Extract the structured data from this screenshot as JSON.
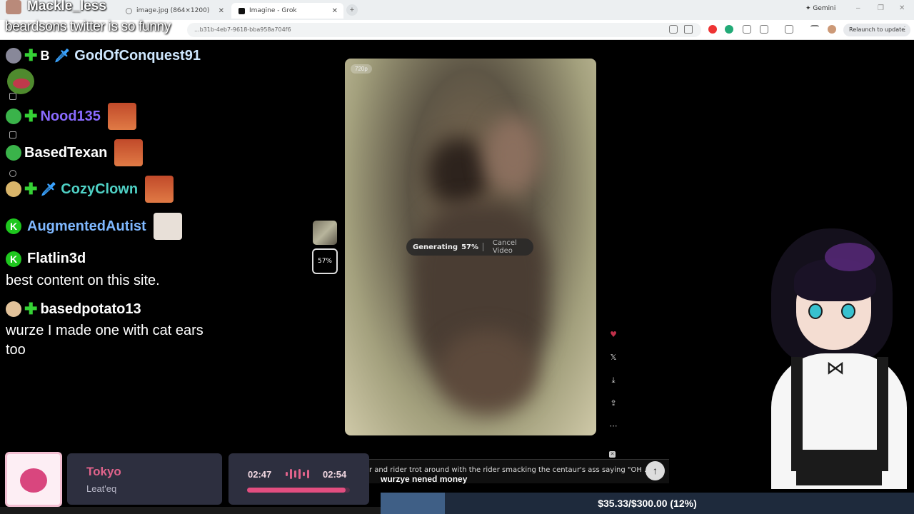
{
  "overlay": {
    "streamer_name": "Mackle_less",
    "stream_title": "beardsons twitter is so funny"
  },
  "browser": {
    "tabs": [
      {
        "label": "image.jpg (864×1200)",
        "active": false
      },
      {
        "label": "Imagine - Grok",
        "active": true
      }
    ],
    "new_tab": "+",
    "gemini_label": "Gemini",
    "url": "...b31b-4eb7-9618-bba958a704f6",
    "relaunch_label": "Relaunch to update",
    "window_controls": [
      "–",
      "❐",
      "✕"
    ]
  },
  "chat": {
    "messages": [
      {
        "user": "GodOfConquest91",
        "color": "#cfe8ff",
        "prefix": "B"
      },
      {
        "user": "Nood135",
        "color": "#8a6bff"
      },
      {
        "user": "BasedTexan",
        "color": "#ffffff"
      },
      {
        "user": "CozyClown",
        "color": "#4fd1c5"
      },
      {
        "user": "AugmentedAutist",
        "color": "#7fb8ff"
      },
      {
        "user": "Flatlin3d",
        "color": "#ffffff",
        "text": "best content on this site."
      },
      {
        "user": "basedpotato13",
        "color": "#ffffff",
        "text": "wurze I made one with cat ears too"
      }
    ]
  },
  "viewer": {
    "resolution": "720p",
    "generating_label": "Generating",
    "progress_text": "57%",
    "cancel_label": "Cancel Video",
    "progress_value": 0.57,
    "thumb_progress": "57%",
    "actions": [
      "heart-icon",
      "x-logo-icon",
      "download-icon",
      "share-icon",
      "more-icon"
    ]
  },
  "prompt": {
    "text": "r and rider trot around with the rider smacking the centaur's ass saying \"OH ...",
    "overlay_text": "wurzye nened money",
    "send_icon": "↑"
  },
  "music": {
    "title": "Tokyo",
    "artist": "Leat'eq",
    "elapsed": "02:47",
    "total": "02:54",
    "progress": 0.96
  },
  "donation": {
    "text": "$35.33/$300.00 (12%)",
    "progress": 0.12
  }
}
